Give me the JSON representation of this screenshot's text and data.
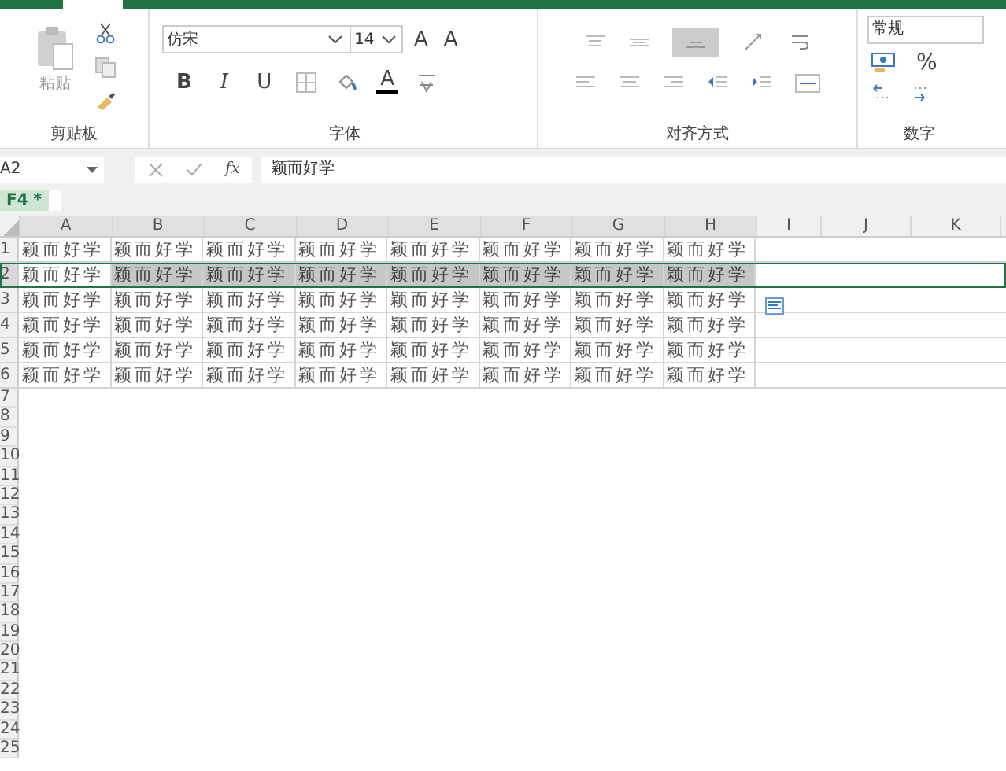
{
  "ribbon": {
    "clipboard": {
      "paste_label": "粘贴",
      "group_label": "剪贴板"
    },
    "font": {
      "name": "仿宋",
      "size": "14",
      "grow": "A",
      "shrink": "A",
      "bold": "B",
      "italic": "I",
      "underline": "U",
      "font_color": "A",
      "group_label": "字体"
    },
    "alignment": {
      "group_label": "对齐方式"
    },
    "number": {
      "format": "常规",
      "percent": "%",
      "group_label": "数字"
    }
  },
  "formula_bar": {
    "name_box": "A2",
    "fx": "fx",
    "value": "颖而好学"
  },
  "sheet_tab": {
    "label": "F4 *"
  },
  "columns": [
    {
      "label": "A",
      "highlighted": true
    },
    {
      "label": "B",
      "highlighted": true
    },
    {
      "label": "C",
      "highlighted": true
    },
    {
      "label": "D",
      "highlighted": true
    },
    {
      "label": "E",
      "highlighted": true
    },
    {
      "label": "F",
      "highlighted": true
    },
    {
      "label": "G",
      "highlighted": true
    },
    {
      "label": "H",
      "highlighted": true
    },
    {
      "label": "I",
      "highlighted": false
    },
    {
      "label": "J",
      "highlighted": false
    },
    {
      "label": "K",
      "highlighted": false
    }
  ],
  "rows": [
    {
      "num": "1",
      "selected": false,
      "cells": [
        {
          "text": "颖而好学",
          "selected": false
        },
        {
          "text": "颖而好学",
          "selected": false
        },
        {
          "text": "颖而好学",
          "selected": false
        },
        {
          "text": "颖而好学",
          "selected": false
        },
        {
          "text": "颖而好学",
          "selected": false
        },
        {
          "text": "颖而好学",
          "selected": false
        },
        {
          "text": "颖而好学",
          "selected": false
        },
        {
          "text": "颖而好学",
          "selected": false
        }
      ]
    },
    {
      "num": "2",
      "selected": true,
      "cells": [
        {
          "text": "颖而好学",
          "selected": false
        },
        {
          "text": "颖而好学",
          "selected": true
        },
        {
          "text": "颖而好学",
          "selected": true
        },
        {
          "text": "颖而好学",
          "selected": true
        },
        {
          "text": "颖而好学",
          "selected": true
        },
        {
          "text": "颖而好学",
          "selected": true
        },
        {
          "text": "颖而好学",
          "selected": true
        },
        {
          "text": "颖而好学",
          "selected": true
        }
      ]
    },
    {
      "num": "3",
      "selected": false,
      "cells": [
        {
          "text": "颖而好学",
          "selected": false
        },
        {
          "text": "颖而好学",
          "selected": false
        },
        {
          "text": "颖而好学",
          "selected": false
        },
        {
          "text": "颖而好学",
          "selected": false
        },
        {
          "text": "颖而好学",
          "selected": false
        },
        {
          "text": "颖而好学",
          "selected": false
        },
        {
          "text": "颖而好学",
          "selected": false
        },
        {
          "text": "颖而好学",
          "selected": false
        }
      ]
    },
    {
      "num": "4",
      "selected": false,
      "cells": [
        {
          "text": "颖而好学",
          "selected": false
        },
        {
          "text": "颖而好学",
          "selected": false
        },
        {
          "text": "颖而好学",
          "selected": false
        },
        {
          "text": "颖而好学",
          "selected": false
        },
        {
          "text": "颖而好学",
          "selected": false
        },
        {
          "text": "颖而好学",
          "selected": false
        },
        {
          "text": "颖而好学",
          "selected": false
        },
        {
          "text": "颖而好学",
          "selected": false
        }
      ]
    },
    {
      "num": "5",
      "selected": false,
      "cells": [
        {
          "text": "颖而好学",
          "selected": false
        },
        {
          "text": "颖而好学",
          "selected": false
        },
        {
          "text": "颖而好学",
          "selected": false
        },
        {
          "text": "颖而好学",
          "selected": false
        },
        {
          "text": "颖而好学",
          "selected": false
        },
        {
          "text": "颖而好学",
          "selected": false
        },
        {
          "text": "颖而好学",
          "selected": false
        },
        {
          "text": "颖而好学",
          "selected": false
        }
      ]
    },
    {
      "num": "6",
      "selected": false,
      "cells": [
        {
          "text": "颖而好学",
          "selected": false
        },
        {
          "text": "颖而好学",
          "selected": false
        },
        {
          "text": "颖而好学",
          "selected": false
        },
        {
          "text": "颖而好学",
          "selected": false
        },
        {
          "text": "颖而好学",
          "selected": false
        },
        {
          "text": "颖而好学",
          "selected": false
        },
        {
          "text": "颖而好学",
          "selected": false
        },
        {
          "text": "颖而好学",
          "selected": false
        }
      ]
    }
  ],
  "empty_rows": [
    "7",
    "8",
    "9",
    "10",
    "11",
    "12",
    "13",
    "14",
    "15",
    "16",
    "17",
    "18",
    "19",
    "20",
    "21",
    "22",
    "23",
    "24",
    "25"
  ]
}
